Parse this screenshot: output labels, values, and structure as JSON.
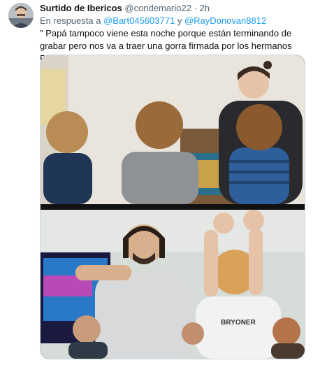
{
  "tweet": {
    "display_name": "Surtido de Ibericos",
    "handle": "@condemario22",
    "separator": "·",
    "time": "2h",
    "reply_prefix": "En respuesta a",
    "reply_mention_1": "@Bart045603771",
    "reply_conjunction": "y",
    "reply_mention_2": "@RayDonovan8812",
    "text": "\" Papá tampoco viene esta noche porque están terminando de grabar pero nos va a traer una gorra firmada por los hermanos Bardem ...\""
  },
  "media": {
    "shirt_text": "BRYONER"
  },
  "colors": {
    "text_primary": "#0f1419",
    "text_secondary": "#536471",
    "link": "#1d9bf0",
    "border": "#cfd9de"
  }
}
